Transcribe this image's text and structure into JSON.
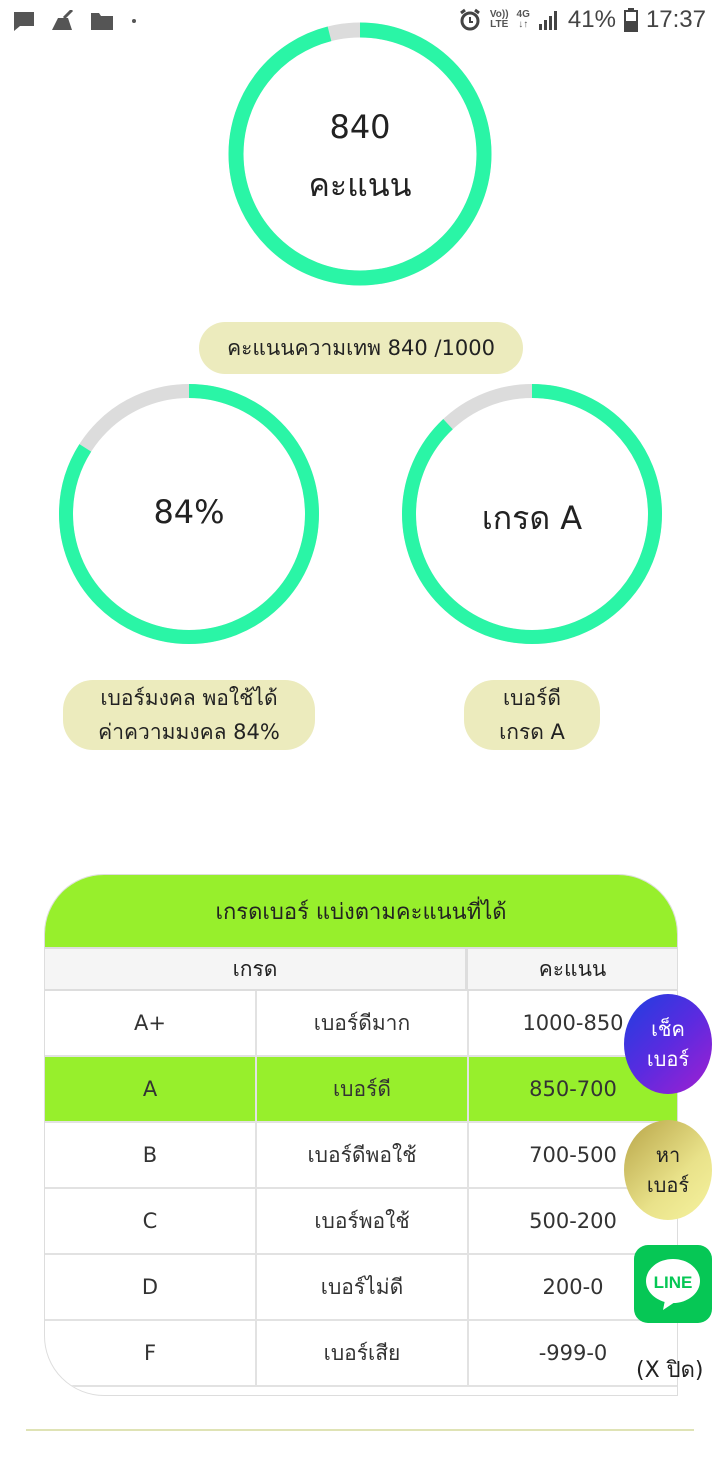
{
  "status_bar": {
    "battery": "41%",
    "time": "17:37",
    "volte_top": "Vo))",
    "volte_bottom": "LTE",
    "network": "4G"
  },
  "main_score": {
    "value_label": "840",
    "unit_label": "คะแนน",
    "progress": 0.96
  },
  "score_pill": "คะแนนความเทพ 840 /1000",
  "lucky_meter": {
    "label": "84%",
    "progress": 0.84,
    "pill_line1": "เบอร์มงคล พอใช้ได้",
    "pill_line2": "ค่าความมงคล 84%"
  },
  "grade_meter": {
    "label": "เกรด A",
    "progress": 0.88,
    "pill_line1": "เบอร์ดี",
    "pill_line2": "เกรด A"
  },
  "grade_table": {
    "title": "เกรดเบอร์ แบ่งตามคะแนนที่ได้",
    "header_grade": "เกรด",
    "header_score": "คะแนน",
    "rows": [
      {
        "grade": "A+",
        "desc": "เบอร์ดีมาก",
        "range": "1000-850"
      },
      {
        "grade": "A",
        "desc": "เบอร์ดี",
        "range": "850-700"
      },
      {
        "grade": "B",
        "desc": "เบอร์ดีพอใช้",
        "range": "700-500"
      },
      {
        "grade": "C",
        "desc": "เบอร์พอใช้",
        "range": "500-200"
      },
      {
        "grade": "D",
        "desc": "เบอร์ไม่ดี",
        "range": "200-0"
      },
      {
        "grade": "F",
        "desc": "เบอร์เสีย",
        "range": "-999-0"
      }
    ]
  },
  "floating": {
    "check_line1": "เช็ค",
    "check_line2": "เบอร์",
    "find_line1": "หา",
    "find_line2": "เบอร์",
    "line_label": "LINE",
    "close_label": "(X ปิด)"
  },
  "colors": {
    "ring_accent": "#2af5a6",
    "ring_track": "#dcdcdc",
    "pill_bg": "#ecebbd",
    "table_highlight": "#97ef2c",
    "line_green": "#06c755"
  }
}
